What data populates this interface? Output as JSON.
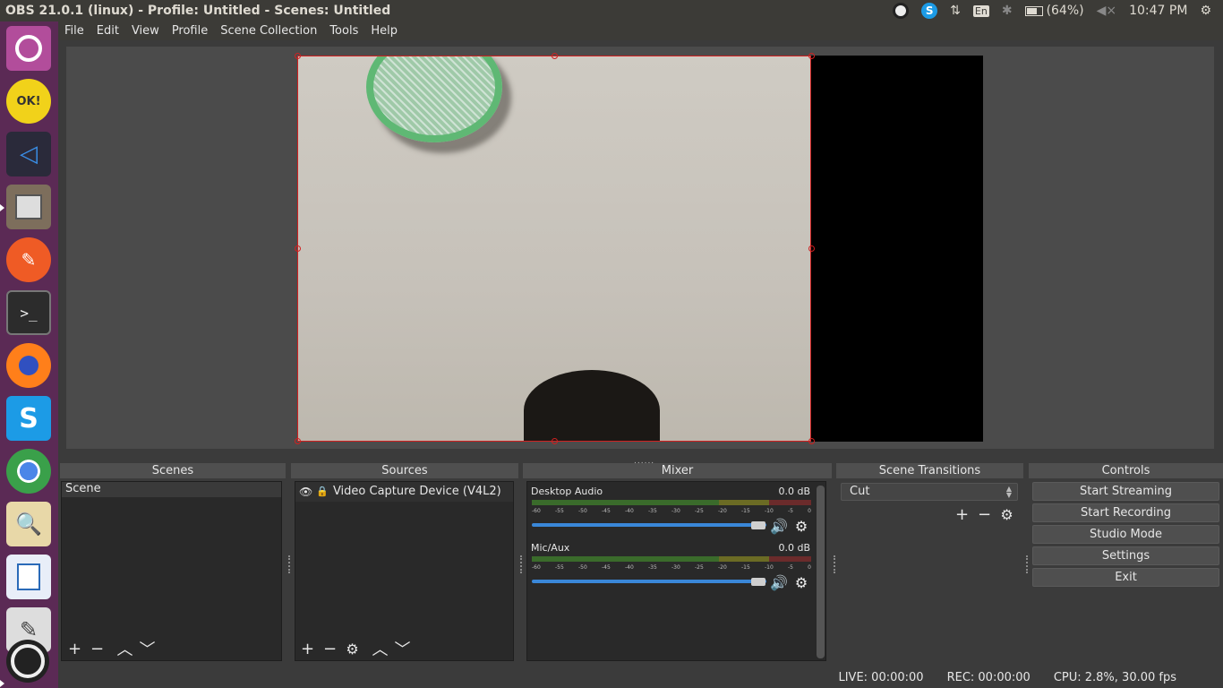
{
  "window": {
    "title": "OBS 21.0.1 (linux) - Profile: Untitled - Scenes: Untitled"
  },
  "indicators": {
    "battery": "(64%)",
    "time": "10:47 PM",
    "keyboard": "En"
  },
  "menu": [
    "File",
    "Edit",
    "View",
    "Profile",
    "Scene Collection",
    "Tools",
    "Help"
  ],
  "docks": {
    "scenes": {
      "title": "Scenes",
      "items": [
        "Scene"
      ]
    },
    "sources": {
      "title": "Sources",
      "items": [
        "Video Capture Device (V4L2)"
      ]
    },
    "mixer": {
      "title": "Mixer",
      "channels": [
        {
          "name": "Desktop Audio",
          "db": "0.0 dB"
        },
        {
          "name": "Mic/Aux",
          "db": "0.0 dB"
        }
      ],
      "ticks": [
        "-60",
        "-55",
        "-50",
        "-45",
        "-40",
        "-35",
        "-30",
        "-25",
        "-20",
        "-15",
        "-10",
        "-5",
        "0"
      ]
    },
    "transitions": {
      "title": "Scene Transitions",
      "selected": "Cut"
    },
    "controls": {
      "title": "Controls",
      "buttons": [
        "Start Streaming",
        "Start Recording",
        "Studio Mode",
        "Settings",
        "Exit"
      ]
    }
  },
  "status": {
    "live": "LIVE: 00:00:00",
    "rec": "REC: 00:00:00",
    "cpu": "CPU: 2.8%, 30.00 fps"
  },
  "launcher": [
    "ubuntu-dash",
    "sticky-notes",
    "vscode",
    "files",
    "postman",
    "terminal",
    "firefox",
    "skype",
    "chrome",
    "image-viewer",
    "writer",
    "text-editor",
    "obs"
  ],
  "colors": {
    "launcher": "#5b2a55",
    "panel": "#292929",
    "accent": "#3a87d8",
    "selection": "#d02020"
  }
}
